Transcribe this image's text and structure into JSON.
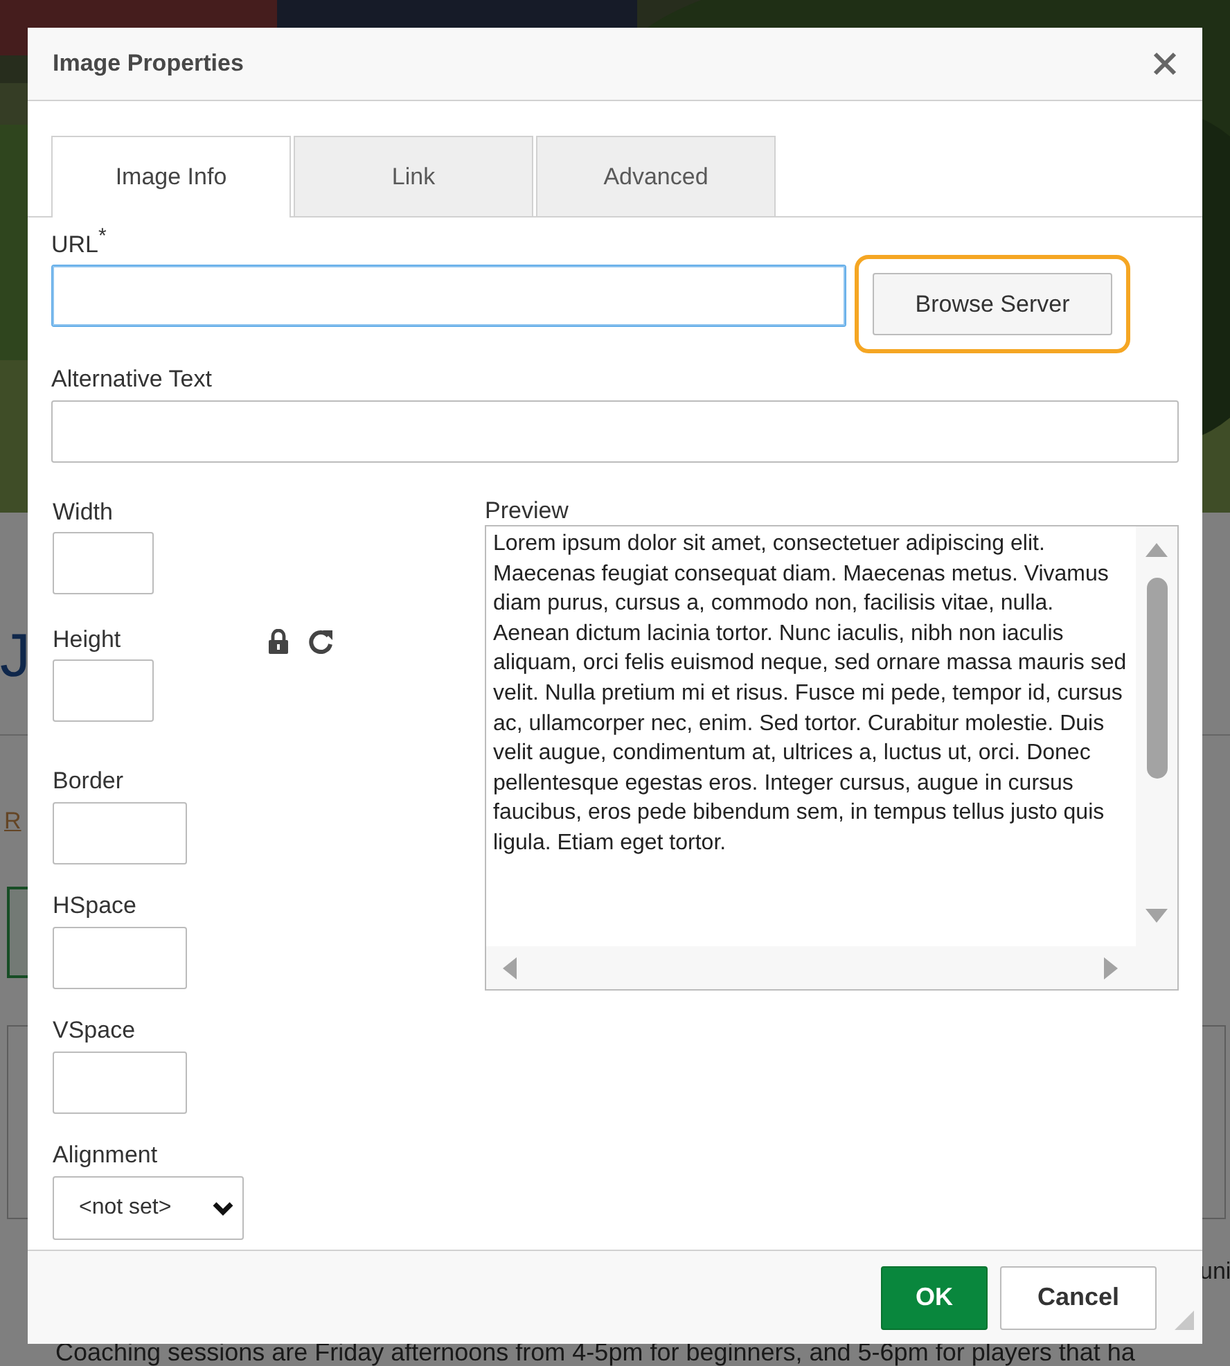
{
  "background": {
    "heading_letter": "J",
    "link_fragment": "R",
    "side_fragment": "uni",
    "paragraph_fragment": "Coaching sessions are Friday afternoons from 4-5pm for beginners, and 5-6pm for players that ha"
  },
  "dialog": {
    "title": "Image Properties",
    "tabs": [
      {
        "label": "Image Info",
        "selected": true
      },
      {
        "label": "Link",
        "selected": false
      },
      {
        "label": "Advanced",
        "selected": false
      }
    ],
    "url": {
      "label": "URL",
      "required_mark": "*",
      "focused": true
    },
    "browse_button": {
      "label": "Browse Server",
      "highlighted": true
    },
    "alt_text": {
      "label": "Alternative Text"
    },
    "dimension_fields": [
      {
        "label": "Width"
      },
      {
        "label": "Height"
      }
    ],
    "spacing_fields": [
      {
        "label": "Border"
      },
      {
        "label": "HSpace"
      },
      {
        "label": "VSpace"
      }
    ],
    "alignment": {
      "label": "Alignment",
      "value": "<not set>"
    },
    "preview": {
      "label": "Preview",
      "text": "Lorem ipsum dolor sit amet, consectetuer adipiscing elit. Maecenas feugiat consequat diam. Maecenas metus. Vivamus diam purus, cursus a, commodo non, facilisis vitae, nulla. Aenean dictum lacinia tortor. Nunc iaculis, nibh non iaculis aliquam, orci felis euismod neque, sed ornare massa mauris sed velit. Nulla pretium mi et risus. Fusce mi pede, tempor id, cursus ac, ullamcorper nec, enim. Sed tortor. Curabitur molestie. Duis velit augue, condimentum at, ultrices a, luctus ut, orci. Donec pellentesque egestas eros. Integer cursus, augue in cursus faucibus, eros pede bibendum sem, in tempus tellus justo quis ligula. Etiam eget tortor."
    },
    "buttons": [
      {
        "label": "OK",
        "kind": "primary"
      },
      {
        "label": "Cancel",
        "kind": "secondary"
      }
    ]
  }
}
